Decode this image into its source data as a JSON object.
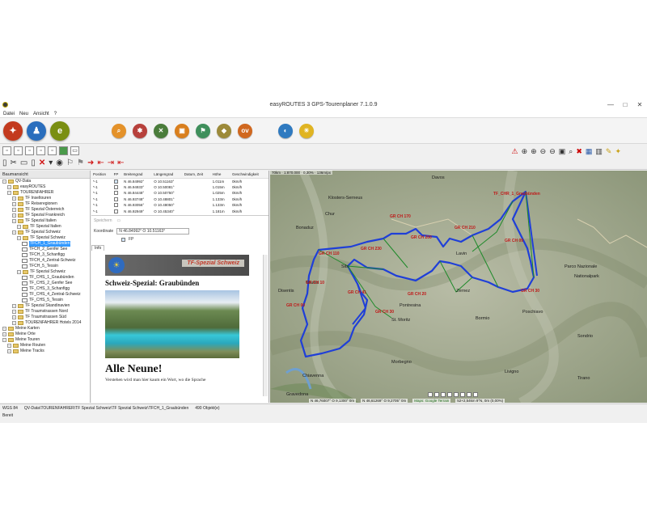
{
  "window": {
    "title": "easyROUTES 3 GPS-Tourenplaner 7.1.0.9",
    "controls": [
      "—",
      "□",
      "✕"
    ]
  },
  "menu": [
    "Datei",
    "Neu",
    "Ansicht",
    "?"
  ],
  "big_toolbar": {
    "group1": [
      {
        "icon": "compass-icon",
        "color": "#c33a1e",
        "glyph": "✦"
      },
      {
        "icon": "hiker-icon",
        "color": "#2a6ebd",
        "glyph": "♟"
      },
      {
        "icon": "e-logo-icon",
        "color": "#7a8f12",
        "glyph": "e"
      }
    ],
    "group2": [
      {
        "icon": "search-icon",
        "color": "#e4922a",
        "glyph": "⌕"
      },
      {
        "icon": "poi-icon",
        "color": "#b7413c",
        "glyph": "✱"
      },
      {
        "icon": "tools-icon",
        "color": "#4a7c3b",
        "glyph": "✕"
      },
      {
        "icon": "tv-icon",
        "color": "#d97f1e",
        "glyph": "▣"
      },
      {
        "icon": "flag-icon",
        "color": "#3f8f5c",
        "glyph": "⚑"
      },
      {
        "icon": "tag-icon",
        "color": "#9c8a3a",
        "glyph": "◆"
      },
      {
        "icon": "ov-icon",
        "color": "#d0681f",
        "glyph": "ov"
      }
    ],
    "group3": [
      {
        "icon": "globe-icon",
        "color": "#2f7ac0",
        "glyph": "◐"
      },
      {
        "icon": "sun-icon",
        "color": "#e0b422",
        "glyph": "☀"
      }
    ]
  },
  "tree": {
    "header": "Baumansicht",
    "nodes": [
      {
        "label": "QV-Data",
        "level": 0,
        "type": "folder"
      },
      {
        "label": "easyROUTES",
        "level": 1,
        "type": "folder"
      },
      {
        "label": "TOURENFAHRER",
        "level": 1,
        "type": "folder"
      },
      {
        "label": "TF Inseltouren",
        "level": 2,
        "type": "folder"
      },
      {
        "label": "TF Reiseregionen",
        "level": 2,
        "type": "folder"
      },
      {
        "label": "TF Spezial Österreich",
        "level": 2,
        "type": "folder"
      },
      {
        "label": "TF Spezial Frankreich",
        "level": 2,
        "type": "folder"
      },
      {
        "label": "TF Spezial Italien",
        "level": 2,
        "type": "folder"
      },
      {
        "label": "TF Spezial Italien",
        "level": 3,
        "type": "folder"
      },
      {
        "label": "TF Spezial Schweiz",
        "level": 2,
        "type": "folder"
      },
      {
        "label": "TF Spezial Schweiz",
        "level": 3,
        "type": "folder"
      },
      {
        "label": "TFCH_1_Graubünden",
        "level": 4,
        "type": "route",
        "selected": true
      },
      {
        "label": "TFCH_2_Genfer See",
        "level": 4,
        "type": "route"
      },
      {
        "label": "TFCH_3_Schanfigg",
        "level": 4,
        "type": "route"
      },
      {
        "label": "TFCH_4_Zentral-Schweiz",
        "level": 4,
        "type": "route"
      },
      {
        "label": "TFCH_5_Tessin",
        "level": 4,
        "type": "route"
      },
      {
        "label": "TF Spezial Schweiz",
        "level": 3,
        "type": "folder"
      },
      {
        "label": "TF_CHS_1_Graubünden",
        "level": 4,
        "type": "route"
      },
      {
        "label": "TF_CHS_2_Genfer See",
        "level": 4,
        "type": "route"
      },
      {
        "label": "TF_CHS_3_Schanfigg",
        "level": 4,
        "type": "route"
      },
      {
        "label": "TF_CHS_4_Zentral-Schweiz",
        "level": 4,
        "type": "route"
      },
      {
        "label": "TF_CHS_5_Tessin",
        "level": 4,
        "type": "route"
      },
      {
        "label": "TF Spezial Skandinavien",
        "level": 2,
        "type": "folder"
      },
      {
        "label": "TF Traumstrassen Nord",
        "level": 2,
        "type": "folder"
      },
      {
        "label": "TF Traumstrassen Süd",
        "level": 2,
        "type": "folder"
      },
      {
        "label": "TOURENFAHRER Hotels 2014",
        "level": 2,
        "type": "folder"
      },
      {
        "label": "Meine Karten",
        "level": 0,
        "type": "folder"
      },
      {
        "label": "Meine Orte",
        "level": 0,
        "type": "folder"
      },
      {
        "label": "Meine Touren",
        "level": 0,
        "type": "folder"
      },
      {
        "label": "Meine Routen",
        "level": 1,
        "type": "folder"
      },
      {
        "label": "Meine Tracks",
        "level": 1,
        "type": "folder"
      }
    ]
  },
  "points_table": {
    "columns": [
      "Position",
      "FP",
      "Breitengrad",
      "Längengrad",
      "Datum, Zeit",
      "Höhe",
      "Geschwindigkeit"
    ],
    "rows": [
      {
        "pos": "*-1",
        "fp": true,
        "lat": "N 46.84992°",
        "lon": "O 10.51163°",
        "date": "",
        "alt": "1.011m",
        "speed": "0km/h"
      },
      {
        "pos": "*-1",
        "fp": false,
        "lat": "N 46.94933°",
        "lon": "O 10.50081°",
        "date": "",
        "alt": "1.015m",
        "speed": "0km/h"
      },
      {
        "pos": "*-1",
        "fp": false,
        "lat": "N 46.84448°",
        "lon": "O 10.50750°",
        "date": "",
        "alt": "1.025m",
        "speed": "0km/h"
      },
      {
        "pos": "*-1",
        "fp": false,
        "lat": "N 46.93748°",
        "lon": "O 10.48801°",
        "date": "",
        "alt": "1.133m",
        "speed": "0km/h"
      },
      {
        "pos": "*-1",
        "fp": false,
        "lat": "N 46.93056°",
        "lon": "O 10.48050°",
        "date": "",
        "alt": "1.133m",
        "speed": "0km/h"
      },
      {
        "pos": "*-1",
        "fp": false,
        "lat": "N 46.92949°",
        "lon": "O 10.45340°",
        "date": "",
        "alt": "1.181m",
        "speed": "0km/h"
      }
    ]
  },
  "coords_panel": {
    "save": "Speichern",
    "label": "Koordinate",
    "value": "N 46.84992° O 10.51163°",
    "fp_label": "FP"
  },
  "info_tab": "Info",
  "info": {
    "banner": "TF-Spezial Schweiz",
    "subtitle": "Schweiz-Spezial: Graubünden",
    "heading": "Alle Neune!",
    "text": "Verstehen wird man hier kaum ein Wort, wo die Sprache"
  },
  "map": {
    "scale": "70km · 1:870.000 · 0,30% · 136m/px",
    "copyright": "Maps: Google Terrain",
    "coord1": "N 46,61269° O 9,2705°   0m",
    "coord2": "52+2,54km 9°N, 0m (0,00%)",
    "coord3": "N 46,76007° O 9,1300°   0m",
    "places": [
      "Klosters-Serneus",
      "Chur",
      "Bonaduz",
      "Davos",
      "Thusis",
      "Sils",
      "Bormio",
      "Chiavenna",
      "Gravedona",
      "Lavin",
      "Zernez",
      "Pontresina",
      "St. Moritz",
      "Livigno",
      "Poschiavo",
      "Tirano",
      "Sondrio",
      "Morbegno",
      "Parco Nazionale",
      "Nationalpark",
      "Disentis"
    ],
    "waypoints": [
      "TF_CHR_1_Graubünden",
      "GR CH 170",
      "GR CH 200",
      "GR CH 210",
      "GR CH 230",
      "GR CH 110",
      "GR CH 10",
      "GR CH 00",
      "GR CH 09",
      "GR CH 41",
      "GR CH 30",
      "GR CH 30",
      "GR CH 20"
    ],
    "colors": {
      "route": "#1f3fd8",
      "connector": "#1e8a2a",
      "label": "#c01818"
    }
  },
  "statusbar": {
    "datum": "WGS 84",
    "path": "QV-Data\\TOURENFAHRER\\TF Spezial Schweiz\\TF Spezial Schweiz\\TFCH_1_Graubünden",
    "count": "490 Objekt(e)"
  },
  "ready": "Bereit"
}
